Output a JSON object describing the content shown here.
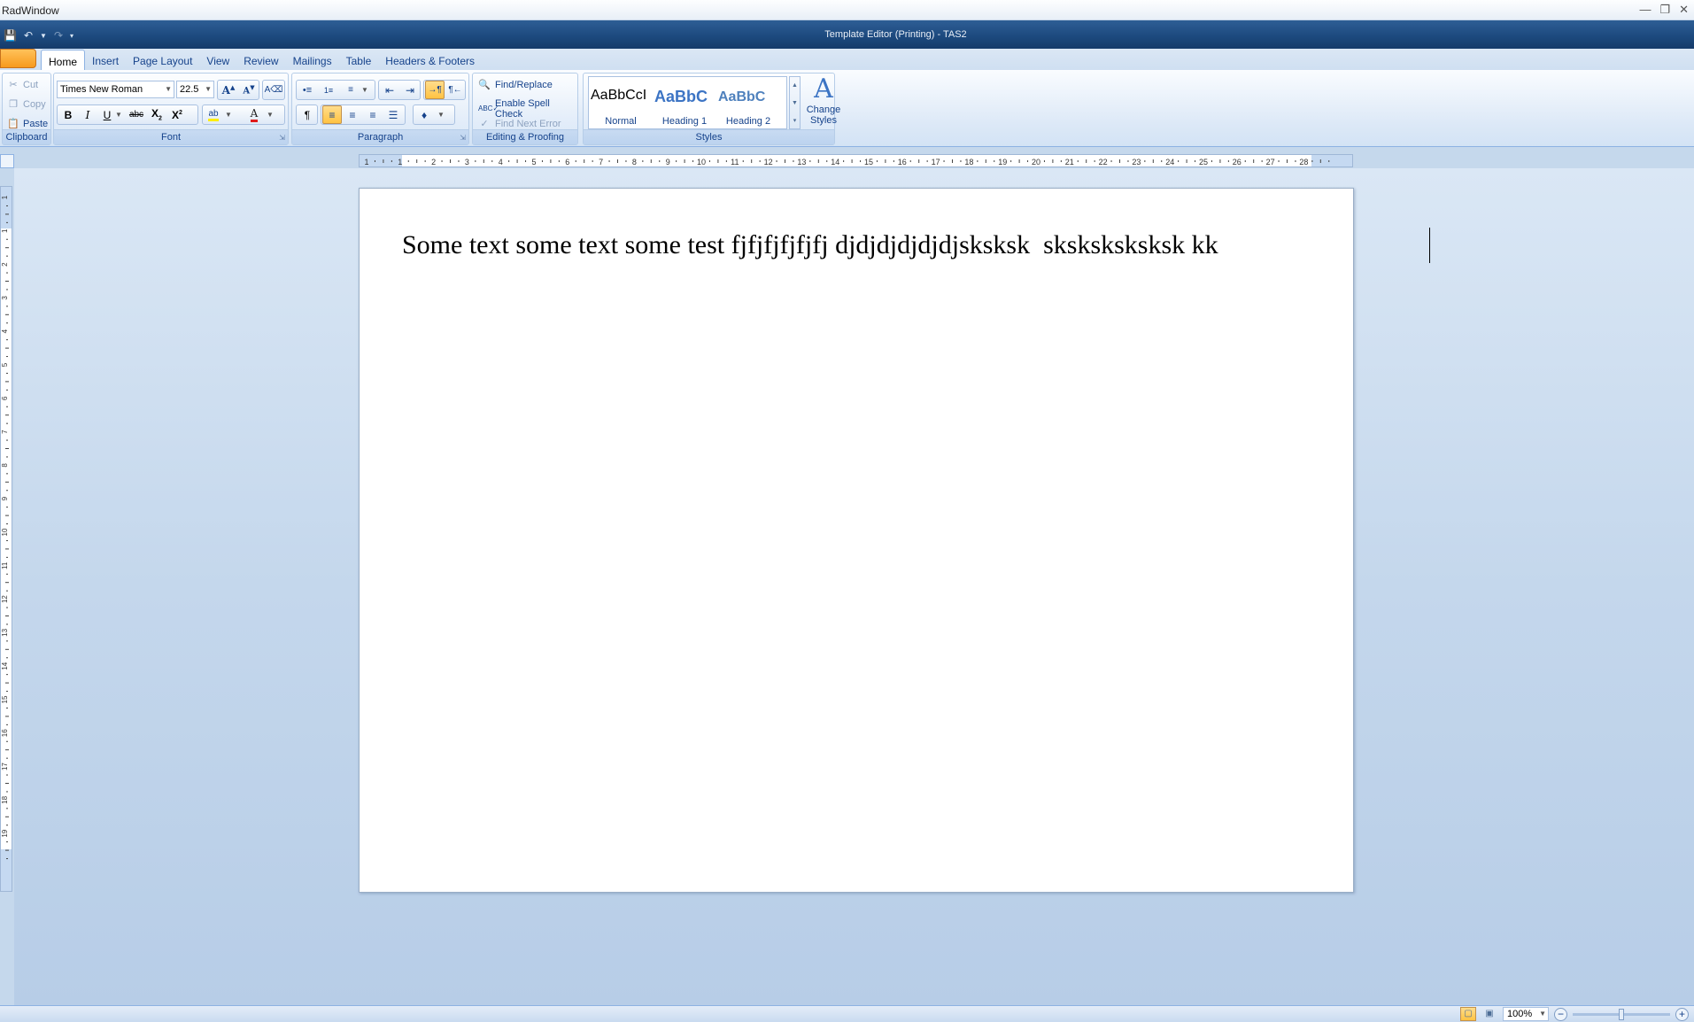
{
  "window": {
    "title": "RadWindow"
  },
  "app": {
    "title": "Template Editor (Printing) - TAS2"
  },
  "tabs": [
    {
      "label": "Home",
      "active": true
    },
    {
      "label": "Insert"
    },
    {
      "label": "Page Layout"
    },
    {
      "label": "View"
    },
    {
      "label": "Review"
    },
    {
      "label": "Mailings"
    },
    {
      "label": "Table"
    },
    {
      "label": "Headers & Footers"
    }
  ],
  "clipboard": {
    "cut": "Cut",
    "copy": "Copy",
    "paste": "Paste",
    "label": "Clipboard"
  },
  "font": {
    "family": "Times New Roman",
    "size": "22.5",
    "label": "Font"
  },
  "paragraph": {
    "label": "Paragraph"
  },
  "editing": {
    "find_replace": "Find/Replace",
    "spell_check": "Enable Spell Check",
    "find_next_error": "Find Next Error",
    "label": "Editing & Proofing"
  },
  "styles": {
    "items": [
      {
        "sample": "AaBbCcI",
        "name": "Normal"
      },
      {
        "sample": "AaBbC",
        "name": "Heading 1"
      },
      {
        "sample": "AaBbC",
        "name": "Heading 2"
      }
    ],
    "change_line1": "Change",
    "change_line2": "Styles",
    "label": "Styles"
  },
  "ruler": {
    "h_labels": [
      "1",
      "1",
      "2",
      "3",
      "4",
      "5",
      "6",
      "7",
      "8",
      "9",
      "10",
      "11",
      "12",
      "13",
      "14",
      "15",
      "16",
      "17",
      "18",
      "19",
      "20",
      "21",
      "22",
      "23",
      "24",
      "25",
      "26",
      "27",
      "28"
    ],
    "v_labels": [
      "1",
      "1",
      "2",
      "3",
      "4",
      "5",
      "6",
      "7",
      "8",
      "9",
      "10",
      "11",
      "12",
      "13",
      "14",
      "15",
      "16",
      "17",
      "18",
      "19"
    ]
  },
  "document": {
    "text": "Some text some text some test fjfjfjfjfjfj djdjdjdjdjdjsksksk  sksksksksksk kk"
  },
  "status": {
    "zoom": "100%"
  },
  "colors": {
    "accent": "#15428b",
    "ribbon_border": "#8db2e3",
    "active_highlight": "#ffc342"
  }
}
